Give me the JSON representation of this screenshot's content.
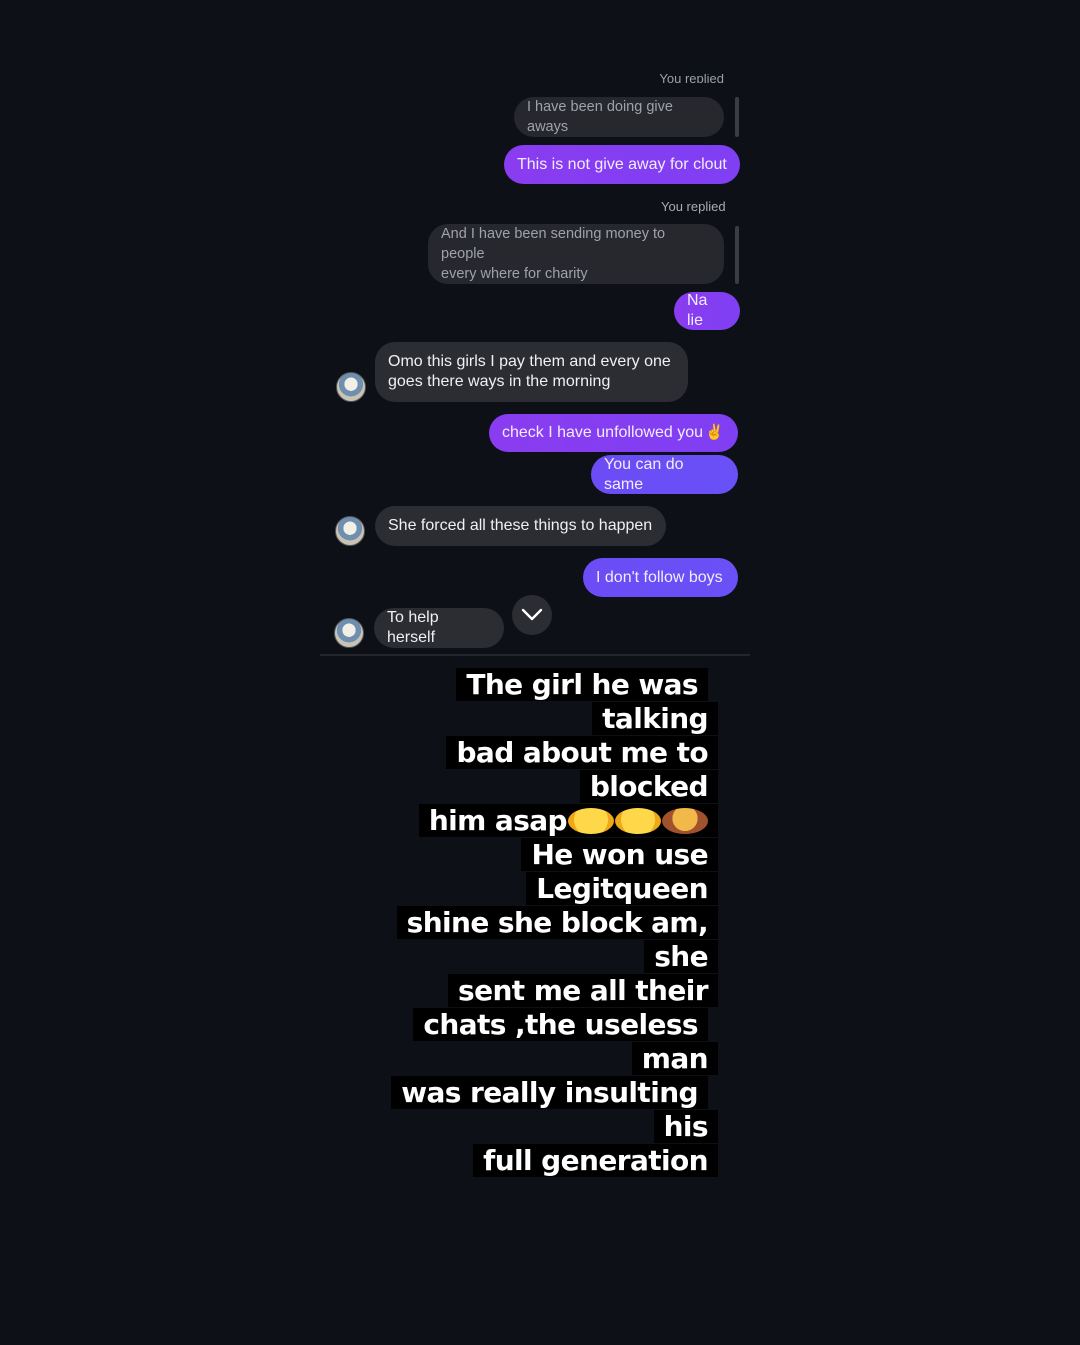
{
  "chat": {
    "cut_label": "You replied",
    "scroll_icon": "chevron-down-icon",
    "messages": [
      {
        "type": "quoted",
        "text": "I have been doing give aways"
      },
      {
        "type": "outgoing",
        "text": "This is not give away for clout"
      },
      {
        "type": "replied_label",
        "text": "You replied"
      },
      {
        "type": "quoted",
        "line1": "And I have been sending money to people",
        "line2": "every where for charity"
      },
      {
        "type": "outgoing",
        "text": "Na lie"
      },
      {
        "type": "incoming",
        "line1": "Omo this girls I pay them and every one",
        "line2": "goes there ways in the morning"
      },
      {
        "type": "outgoing",
        "text": "check I have unfollowed you",
        "emoji": "✌️"
      },
      {
        "type": "outgoing",
        "text": "You can do same"
      },
      {
        "type": "incoming",
        "text": "She forced all these things to happen"
      },
      {
        "type": "outgoing",
        "text": "I don't follow boys"
      },
      {
        "type": "incoming",
        "text": "To help herself"
      }
    ]
  },
  "caption": {
    "lines": [
      "The girl he was talking",
      "bad about me to blocked",
      "him asap",
      "He won use Legitqueen",
      "shine she block am, she",
      "sent me all their",
      "chats ,the useless man",
      "was really insulting his",
      "full generation"
    ],
    "emojis": [
      "😂",
      "🤣",
      "🤦‍♀️"
    ]
  },
  "colors": {
    "background": "#0d1016",
    "outgoing_purple": "#8a3cf0",
    "outgoing_blue": "#6a50f7",
    "incoming": "#2b2d32"
  }
}
